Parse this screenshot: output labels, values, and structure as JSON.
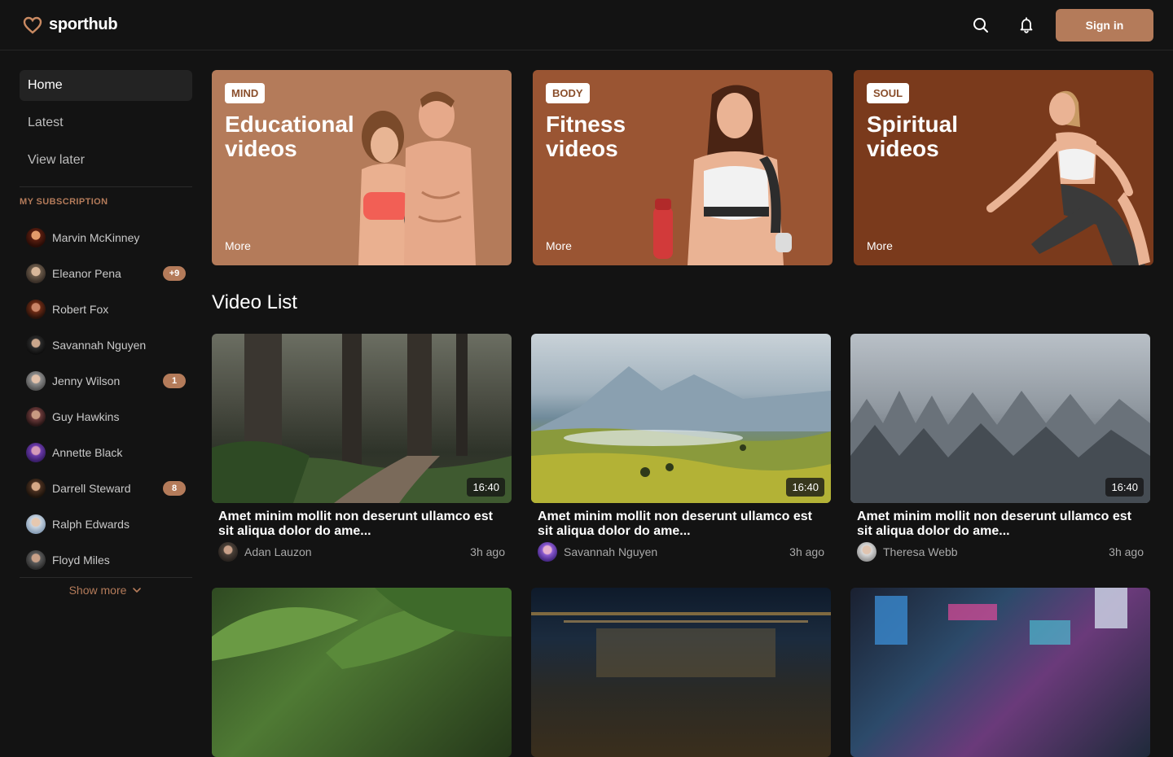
{
  "header": {
    "logo_text": "sporthub",
    "signin_label": "Sign in"
  },
  "sidebar": {
    "nav": [
      {
        "label": "Home",
        "active": true
      },
      {
        "label": "Latest",
        "active": false
      },
      {
        "label": "View later",
        "active": false
      }
    ],
    "subscription_heading": "MY SUBSCRIPTION",
    "subscriptions": [
      {
        "name": "Marvin McKinney",
        "badge": ""
      },
      {
        "name": "Eleanor Pena",
        "badge": "+9"
      },
      {
        "name": "Robert Fox",
        "badge": ""
      },
      {
        "name": "Savannah Nguyen",
        "badge": ""
      },
      {
        "name": "Jenny Wilson",
        "badge": "1"
      },
      {
        "name": "Guy Hawkins",
        "badge": ""
      },
      {
        "name": "Annette Black",
        "badge": ""
      },
      {
        "name": "Darrell Steward",
        "badge": "8"
      },
      {
        "name": "Ralph Edwards",
        "badge": ""
      },
      {
        "name": "Floyd Miles",
        "badge": ""
      }
    ],
    "show_more": "Show more"
  },
  "banners": [
    {
      "tag": "MIND",
      "title_line1": "Educational",
      "title_line2": "videos",
      "more": "More",
      "color": "#b47b5a"
    },
    {
      "tag": "BODY",
      "title_line1": "Fitness",
      "title_line2": "videos",
      "more": "More",
      "color": "#9a5533"
    },
    {
      "tag": "SOUL",
      "title_line1": "Spiritual",
      "title_line2": "videos",
      "more": "More",
      "color": "#7a3a1c"
    }
  ],
  "video_list": {
    "title": "Video List",
    "videos": [
      {
        "duration": "16:40",
        "title": "Amet minim mollit non deserunt ullamco est sit aliqua dolor do ame...",
        "author": "Adan Lauzon",
        "time": "3h ago"
      },
      {
        "duration": "16:40",
        "title": "Amet minim mollit non deserunt ullamco est sit aliqua dolor do ame...",
        "author": "Savannah Nguyen",
        "time": "3h ago"
      },
      {
        "duration": "16:40",
        "title": "Amet minim mollit non deserunt ullamco est sit aliqua dolor do ame...",
        "author": "Theresa Webb",
        "time": "3h ago"
      }
    ]
  },
  "colors": {
    "accent": "#b47b5a",
    "background": "#131313"
  }
}
